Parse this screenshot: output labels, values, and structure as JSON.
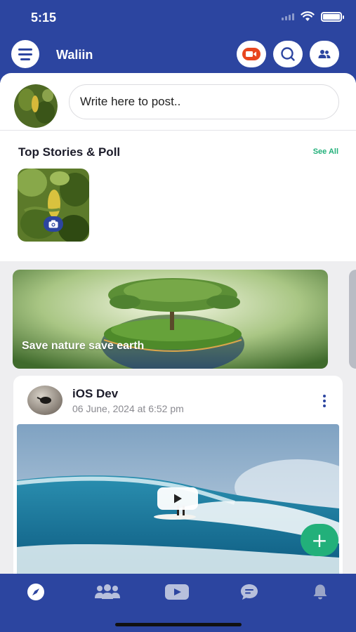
{
  "status_bar": {
    "time": "5:15"
  },
  "header": {
    "title": "Waliin",
    "icons": [
      "menu-icon",
      "video-camera-icon",
      "search-icon",
      "people-icon"
    ],
    "colors": {
      "primary": "#2c45a0",
      "video_button_accent": "#e8461f"
    }
  },
  "composer": {
    "placeholder": "Write here to post.."
  },
  "stories": {
    "title": "Top Stories & Poll",
    "see_all": "See All"
  },
  "banner": {
    "text": "Save nature save earth"
  },
  "post": {
    "author": "iOS Dev",
    "date": "06 June, 2024 at 6:52 pm",
    "media_type": "video"
  },
  "fab": {
    "label": "+",
    "color": "#22b07a"
  },
  "tabbar": {
    "items": [
      "compass-icon",
      "community-icon",
      "video-icon",
      "chat-icon",
      "bell-icon"
    ],
    "active": "compass-icon"
  }
}
